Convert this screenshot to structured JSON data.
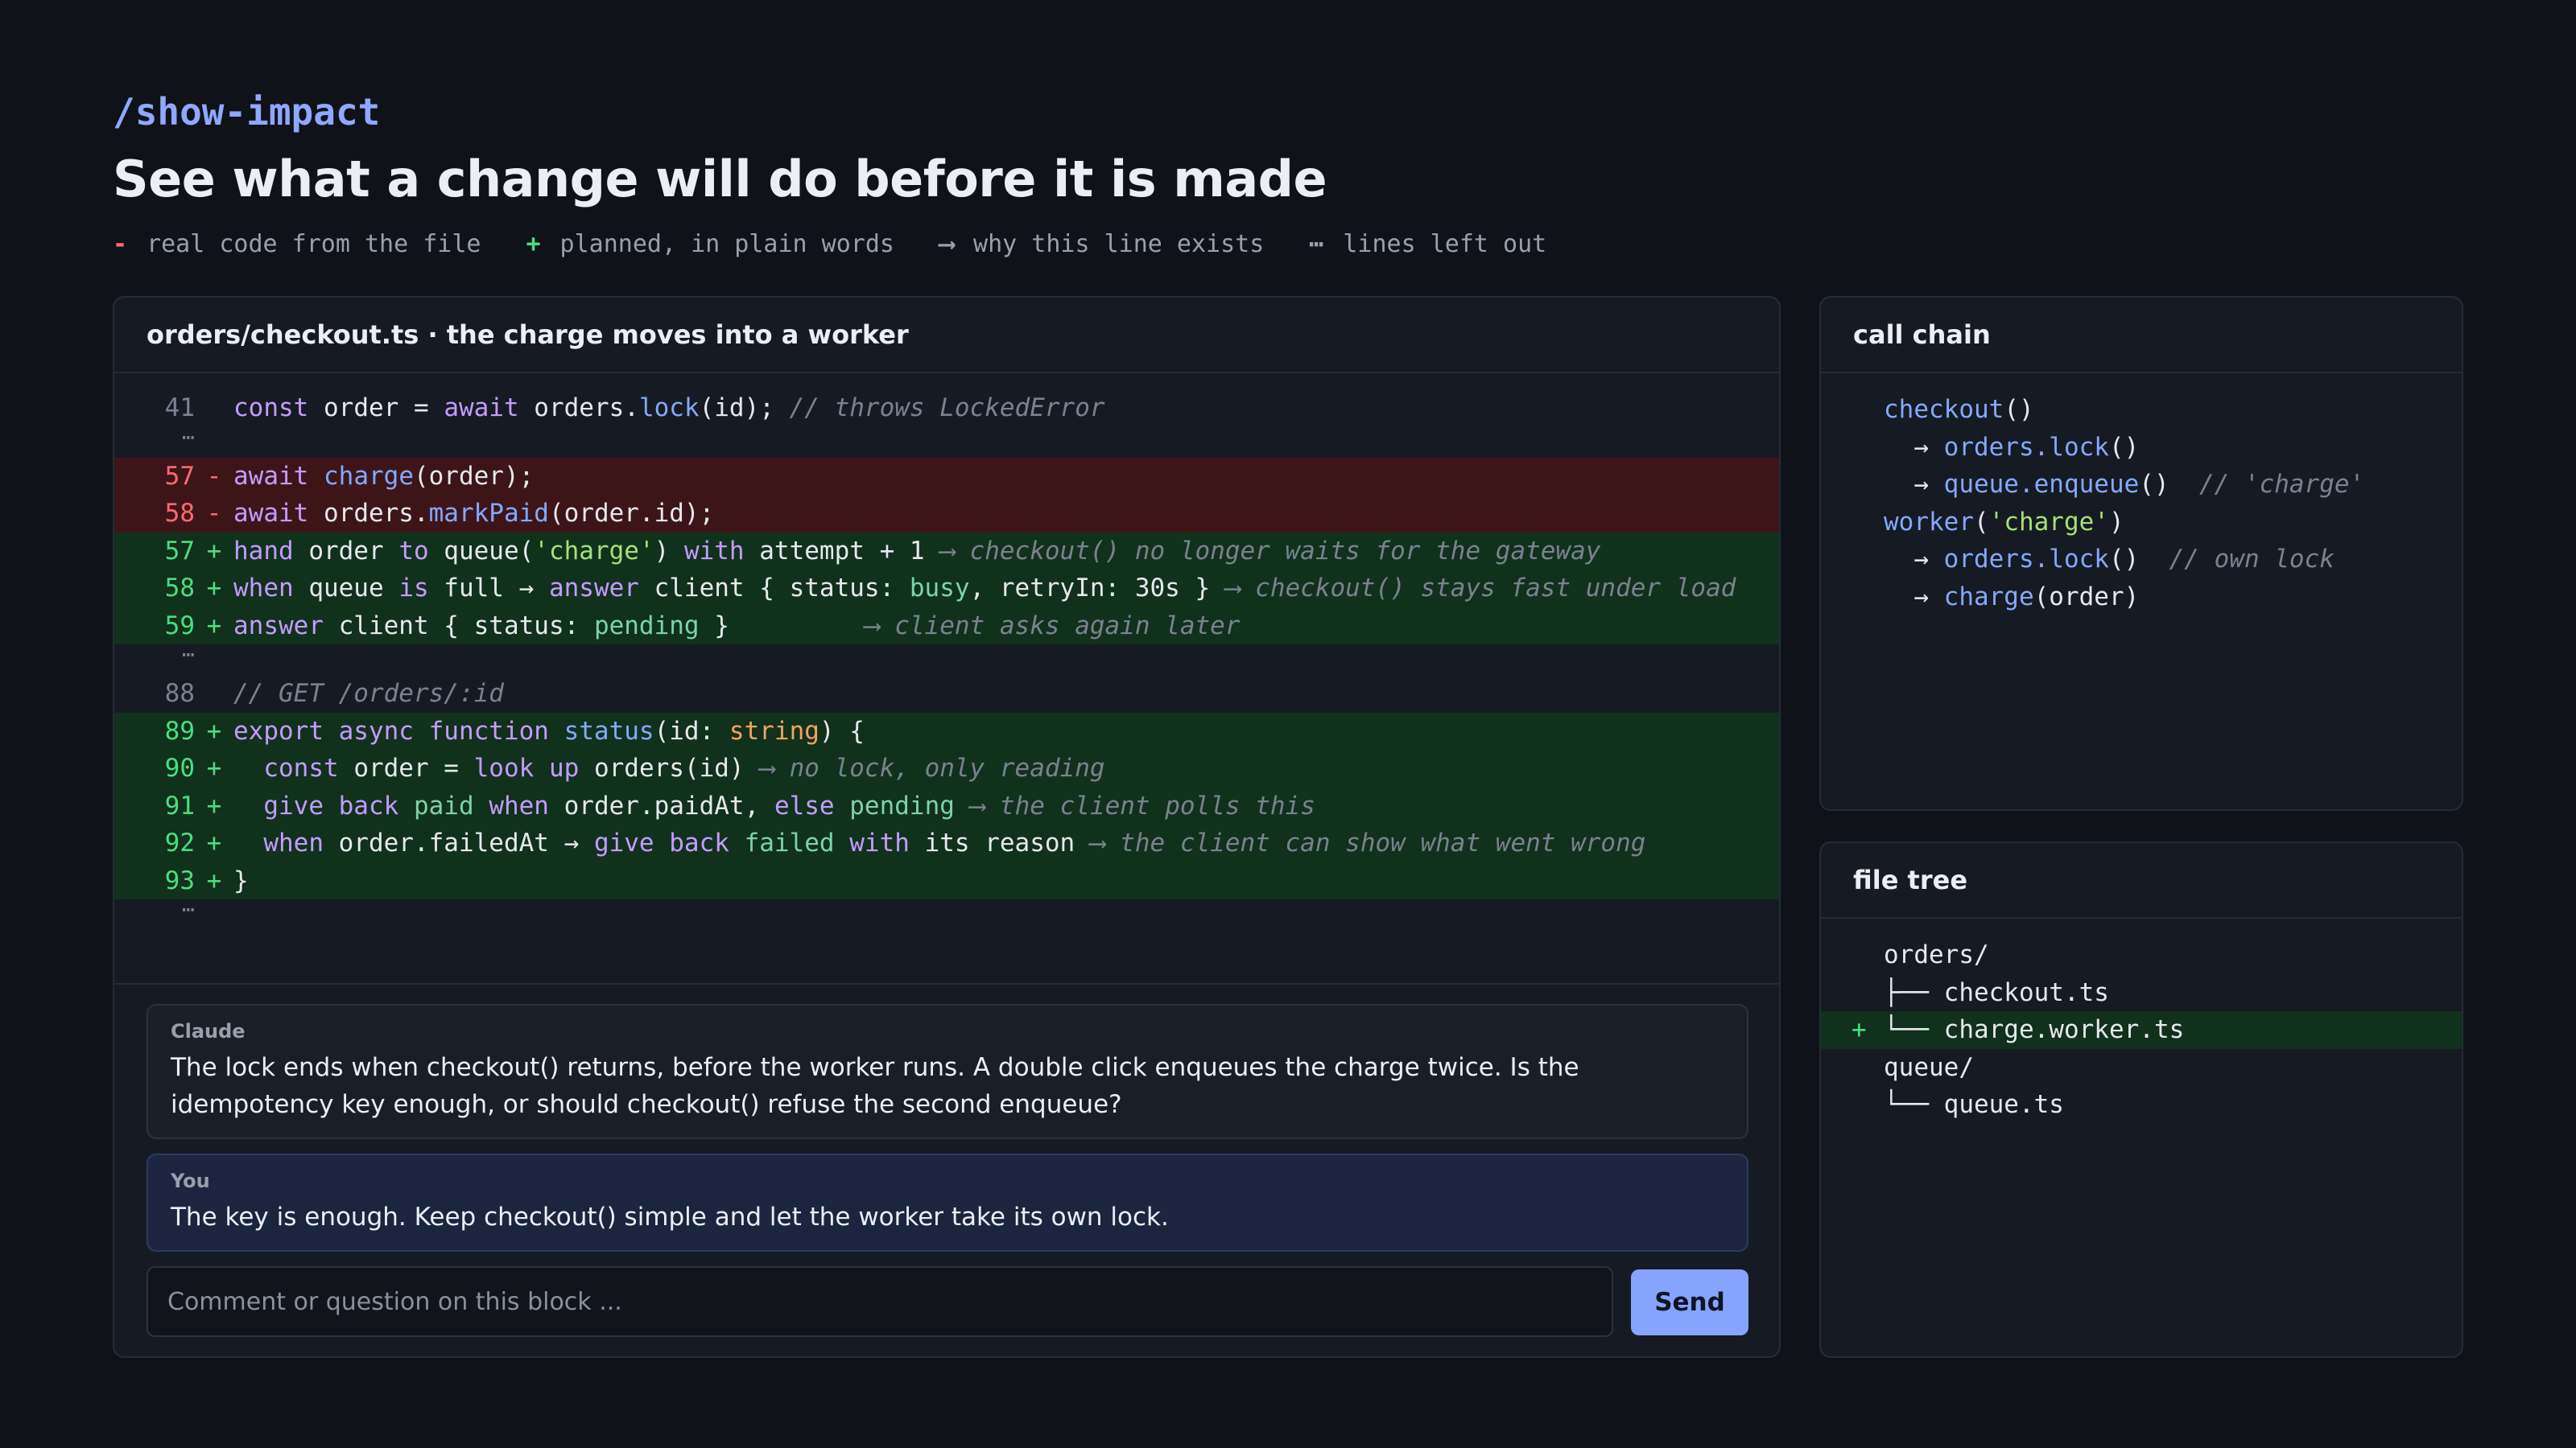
{
  "header": {
    "command": "/show-impact",
    "title": "See what a change will do before it is made",
    "legend": [
      {
        "mark": "-",
        "label": "real code from the file",
        "kind": "minus"
      },
      {
        "mark": "+",
        "label": "planned, in plain words",
        "kind": "plus"
      },
      {
        "mark": "⟶",
        "label": "why this line exists",
        "kind": "arrow"
      },
      {
        "mark": "⋯",
        "label": "lines left out",
        "kind": "dots"
      }
    ]
  },
  "diff": {
    "title": "orders/checkout.ts · the charge moves into a worker",
    "lines": [
      {
        "type": "ctx",
        "ln": "41",
        "tokens": [
          [
            "kw",
            "const"
          ],
          [
            "plain",
            " order = "
          ],
          [
            "kw",
            "await"
          ],
          [
            "plain",
            " orders."
          ],
          [
            "fn",
            "lock"
          ],
          [
            "plain",
            "(id); "
          ],
          [
            "cm",
            "// throws LockedError"
          ]
        ]
      },
      {
        "type": "gap"
      },
      {
        "type": "del",
        "ln": "57",
        "tokens": [
          [
            "kw",
            "await"
          ],
          [
            "plain",
            " "
          ],
          [
            "fn",
            "charge"
          ],
          [
            "plain",
            "(order);"
          ]
        ]
      },
      {
        "type": "del",
        "ln": "58",
        "tokens": [
          [
            "kw",
            "await"
          ],
          [
            "plain",
            " orders."
          ],
          [
            "fn",
            "markPaid"
          ],
          [
            "plain",
            "(order.id);"
          ]
        ]
      },
      {
        "type": "add",
        "ln": "57",
        "tokens": [
          [
            "kw",
            "hand"
          ],
          [
            "plain",
            " order "
          ],
          [
            "kw",
            "to"
          ],
          [
            "plain",
            " queue("
          ],
          [
            "str",
            "'charge'"
          ],
          [
            "plain",
            ") "
          ],
          [
            "kw",
            "with"
          ],
          [
            "plain",
            " attempt + 1 "
          ],
          [
            "cm",
            "⟶ checkout() no longer waits for the gateway"
          ]
        ]
      },
      {
        "type": "add",
        "ln": "58",
        "tokens": [
          [
            "kw",
            "when"
          ],
          [
            "plain",
            " queue "
          ],
          [
            "kw",
            "is"
          ],
          [
            "plain",
            " full → "
          ],
          [
            "kw",
            "answer"
          ],
          [
            "plain",
            " client { status: "
          ],
          [
            "val",
            "busy"
          ],
          [
            "plain",
            ", retryIn: 30s } "
          ],
          [
            "cm",
            "⟶ checkout() stays fast under load"
          ]
        ]
      },
      {
        "type": "add",
        "ln": "59",
        "tokens": [
          [
            "kw",
            "answer"
          ],
          [
            "plain",
            " client { status: "
          ],
          [
            "val",
            "pending"
          ],
          [
            "plain",
            " }         "
          ],
          [
            "cm",
            "⟶ client asks again later"
          ]
        ]
      },
      {
        "type": "gap"
      },
      {
        "type": "ctx",
        "ln": "88",
        "tokens": [
          [
            "cm",
            "// GET /orders/:id"
          ]
        ]
      },
      {
        "type": "add",
        "ln": "89",
        "tokens": [
          [
            "kw",
            "export async function"
          ],
          [
            "plain",
            " "
          ],
          [
            "fn",
            "status"
          ],
          [
            "plain",
            "(id: "
          ],
          [
            "typ",
            "string"
          ],
          [
            "plain",
            ") {"
          ]
        ]
      },
      {
        "type": "add",
        "ln": "90",
        "tokens": [
          [
            "plain",
            "  "
          ],
          [
            "kw",
            "const"
          ],
          [
            "plain",
            " order = "
          ],
          [
            "kw",
            "look up"
          ],
          [
            "plain",
            " orders(id) "
          ],
          [
            "cm",
            "⟶ no lock, only reading"
          ]
        ]
      },
      {
        "type": "add",
        "ln": "91",
        "tokens": [
          [
            "plain",
            "  "
          ],
          [
            "kw",
            "give back"
          ],
          [
            "plain",
            " "
          ],
          [
            "val",
            "paid"
          ],
          [
            "plain",
            " "
          ],
          [
            "kw",
            "when"
          ],
          [
            "plain",
            " order.paidAt, "
          ],
          [
            "kw",
            "else"
          ],
          [
            "plain",
            " "
          ],
          [
            "val",
            "pending"
          ],
          [
            "plain",
            " "
          ],
          [
            "cm",
            "⟶ the client polls this"
          ]
        ]
      },
      {
        "type": "add",
        "ln": "92",
        "tokens": [
          [
            "plain",
            "  "
          ],
          [
            "kw",
            "when"
          ],
          [
            "plain",
            " order.failedAt → "
          ],
          [
            "kw",
            "give back"
          ],
          [
            "plain",
            " "
          ],
          [
            "val",
            "failed"
          ],
          [
            "plain",
            " "
          ],
          [
            "kw",
            "with"
          ],
          [
            "plain",
            " its reason "
          ],
          [
            "cm",
            "⟶ the client can show what went wrong"
          ]
        ]
      },
      {
        "type": "add",
        "ln": "93",
        "tokens": [
          [
            "plain",
            "}"
          ]
        ]
      },
      {
        "type": "gap"
      }
    ],
    "gap_glyph": "⋯"
  },
  "thread": {
    "claude": {
      "author": "Claude",
      "text": "The lock ends when checkout() returns, before the worker runs. A double click enqueues the charge twice. Is the idempotency key enough, or should checkout() refuse the second enqueue?"
    },
    "you": {
      "author": "You",
      "text": "The key is enough. Keep checkout() simple and let the worker take its own lock."
    },
    "input_placeholder": "Comment or question on this block ...",
    "send_label": "Send"
  },
  "call_chain": {
    "title": "call chain",
    "lines": [
      [
        [
          "fn",
          "checkout"
        ],
        [
          "plain",
          "()"
        ]
      ],
      [
        [
          "plain",
          "  → "
        ],
        [
          "fn",
          "orders.lock"
        ],
        [
          "plain",
          "()"
        ]
      ],
      [
        [
          "plain",
          "  → "
        ],
        [
          "fn",
          "queue.enqueue"
        ],
        [
          "plain",
          "()  "
        ],
        [
          "cm",
          "// 'charge'"
        ]
      ],
      [
        [
          "fn",
          "worker"
        ],
        [
          "plain",
          "("
        ],
        [
          "str",
          "'charge'"
        ],
        [
          "plain",
          ")"
        ]
      ],
      [
        [
          "plain",
          "  → "
        ],
        [
          "fn",
          "orders.lock"
        ],
        [
          "plain",
          "()  "
        ],
        [
          "cm",
          "// own lock"
        ]
      ],
      [
        [
          "plain",
          "  → "
        ],
        [
          "fn",
          "charge"
        ],
        [
          "plain",
          "(order)"
        ]
      ]
    ]
  },
  "file_tree": {
    "title": "file tree",
    "items": [
      {
        "text": "orders/",
        "added": false
      },
      {
        "text": "├── checkout.ts",
        "added": false
      },
      {
        "text": "└── charge.worker.ts",
        "added": true
      },
      {
        "text": "queue/",
        "added": false
      },
      {
        "text": "└── queue.ts",
        "added": false
      }
    ],
    "added_mark": "+"
  }
}
